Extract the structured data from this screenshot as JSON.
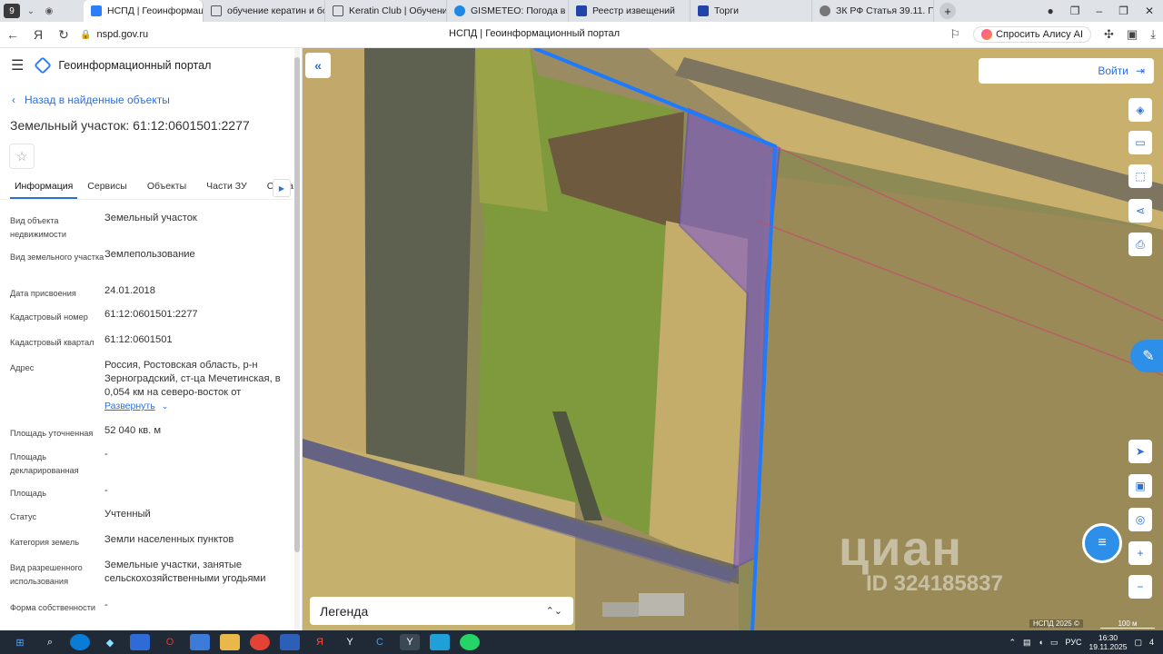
{
  "browser": {
    "tab_count": "9",
    "tabs": [
      {
        "label": "НСПД | Геоинформаци",
        "active": true,
        "color": "#2d7ff9"
      },
      {
        "label": "обучение кератин и бото",
        "active": false,
        "color": "#555555"
      },
      {
        "label": "Keratin Club | Обучение к",
        "active": false,
        "color": "#555555"
      },
      {
        "label": "GISMETEO: Погода в Зер",
        "active": false,
        "color": "#1e88e5"
      },
      {
        "label": "Реестр извещений",
        "active": false,
        "color": "#2244aa"
      },
      {
        "label": "Торги",
        "active": false,
        "color": "#2244aa"
      },
      {
        "label": "ЗК РФ Статья 39.11. Под",
        "active": false,
        "color": "#777777"
      }
    ],
    "url": "nspd.gov.ru",
    "page_title": "НСПД | Геоинформационный портал",
    "alice_label": "Спросить Алису AI",
    "downloads_badge": "3"
  },
  "panel": {
    "portal_title": "Геоинформационный портал",
    "back_label": "Назад в найденные объекты",
    "object_title": "Земельный участок: 61:12:0601501:2277",
    "tabs": [
      "Информация",
      "Сервисы",
      "Объекты",
      "Части ЗУ",
      "Соста"
    ],
    "properties": [
      {
        "key": "Вид объекта недвижимости",
        "value": "Земельный участок"
      },
      {
        "key": "Вид земельного участка",
        "value": "Землепользование"
      },
      {
        "key": "Дата присвоения",
        "value": "24.01.2018"
      },
      {
        "key": "Кадастровый номер",
        "value": "61:12:0601501:2277"
      },
      {
        "key": "Кадастровый квартал",
        "value": "61:12:0601501"
      },
      {
        "key": "Адрес",
        "value": "Россия, Ростовская область, р-н Зерноградский, ст-ца Мечетинская, в 0,054 км на северо-восток от"
      },
      {
        "key": "Площадь уточненная",
        "value": "52 040 кв. м"
      },
      {
        "key": "Площадь декларированная",
        "value": "-"
      },
      {
        "key": "Площадь",
        "value": "-"
      },
      {
        "key": "Статус",
        "value": "Учтенный"
      },
      {
        "key": "Категория земель",
        "value": "Земли населенных пунктов"
      },
      {
        "key": "Вид разрешенного использования",
        "value": "Земельные участки, занятые сельскохозяйственными угодьями"
      },
      {
        "key": "Форма собственности",
        "value": "-"
      }
    ],
    "expand_label": "Развернуть"
  },
  "map": {
    "login_label": "Войти",
    "legend_label": "Легенда",
    "watermark_text": "циан",
    "watermark_id": "ID 324185837",
    "attribution": "НСПД 2025 ©",
    "scale_label": "100 м",
    "parcel_color": "#7a52d6",
    "boundary_color": "#1e7bff"
  },
  "taskbar": {
    "language": "РУС",
    "time": "16:30",
    "date": "19.11.2025",
    "notifications": "4"
  }
}
